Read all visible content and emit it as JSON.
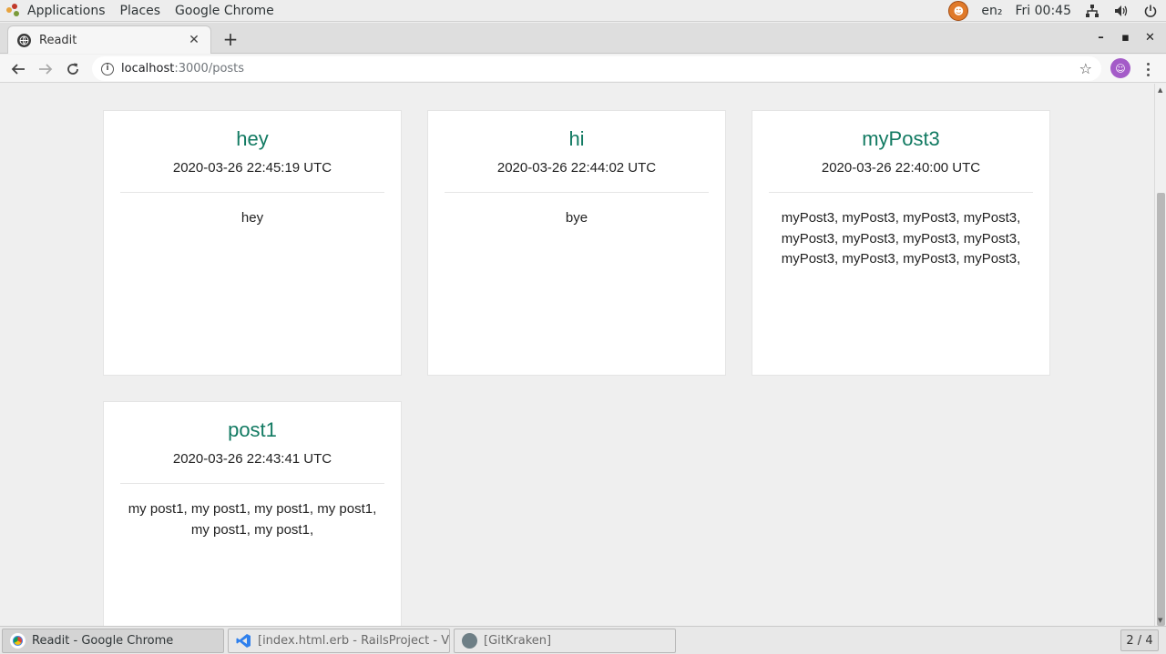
{
  "topbar": {
    "applications": "Applications",
    "places": "Places",
    "browser": "Google Chrome",
    "language": "en₂",
    "clock": "Fri 00:45"
  },
  "browser": {
    "tab_title": "Readit",
    "url_host": "localhost",
    "url_path": ":3000/posts"
  },
  "posts": [
    {
      "title": "hey",
      "date": "2020-03-26 22:45:19 UTC",
      "body": "hey"
    },
    {
      "title": "hi",
      "date": "2020-03-26 22:44:02 UTC",
      "body": "bye"
    },
    {
      "title": "myPost3",
      "date": "2020-03-26 22:40:00 UTC",
      "body": "myPost3, myPost3, myPost3, myPost3, myPost3, myPost3, myPost3, myPost3, myPost3, myPost3, myPost3, myPost3,"
    },
    {
      "title": "post1",
      "date": "2020-03-26 22:43:41 UTC",
      "body": "my post1, my post1, my post1, my post1, my post1, my post1,"
    }
  ],
  "taskbar": {
    "tasks": [
      {
        "label": "Readit - Google Chrome",
        "active": true
      },
      {
        "label": "[index.html.erb - RailsProject - Visual...",
        "active": false
      },
      {
        "label": "[GitKraken]",
        "active": false
      }
    ],
    "workspace": "2 / 4"
  },
  "colors": {
    "post_title": "#127a62",
    "profile_avatar": "#a45bc8",
    "page_background": "#efefef"
  }
}
